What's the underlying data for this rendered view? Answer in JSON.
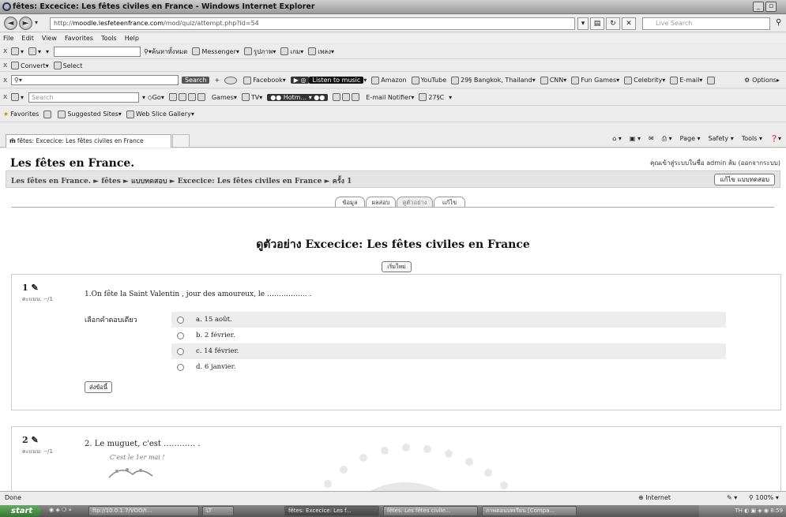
{
  "window": {
    "title": "fêtes: Excecice: Les fêtes civiles en France - Windows Internet Explorer"
  },
  "address": {
    "url_prefix": "http://",
    "url_host": "moodle.lesfeteenfrance.com",
    "url_path": "/mod/quiz/attempt.php?id=54",
    "search_placeholder": "Live Search"
  },
  "menu": [
    "File",
    "Edit",
    "View",
    "Favorites",
    "Tools",
    "Help"
  ],
  "toolbar2": {
    "search_label": "ค้นหาทั้งหมด",
    "messenger": "Messenger",
    "item3": "รูปภาพ",
    "item4": "เกม",
    "item5": "เพลง"
  },
  "toolbar3": {
    "convert": "Convert",
    "select": "Select"
  },
  "toolbar4": {
    "search_btn": "Search",
    "items": [
      "Facebook",
      "Listen to music",
      "Amazon",
      "YouTube",
      "29§ Bangkok, Thailand",
      "CNN",
      "Fun Games",
      "Celebrity",
      "E-mail"
    ],
    "options": "Options"
  },
  "toolbar5": {
    "search_placeholder": "Search",
    "go": "Go",
    "games": "Games",
    "tv": "TV",
    "hotmail": "Hotm...",
    "email_notifier": "E-mail Notifier",
    "temp": "27§C"
  },
  "favbar": {
    "favorites": "Favorites",
    "suggested": "Suggested Sites",
    "web_slice": "Web Slice Gallery"
  },
  "tab": {
    "title": "fêtes: Excecice: Les fêtes civiles en France"
  },
  "tabtools": [
    "Page",
    "Safety",
    "Tools"
  ],
  "page": {
    "site_title": "Les fêtes en France.",
    "login_info": "คุณเข้าสู่ระบบในชื่อ admin ส้ม (ออกจากระบบ)",
    "breadcrumb": "Les fêtes en France. ► fêtes ► แบบทดสอบ ► Excecice: Les fêtes civiles en France ► ครั้ง 1",
    "edit_button": "แก้ไข แบบทดสอบ",
    "tabs": [
      "ข้อมูล",
      "ผลสอบ",
      "ดูตัวอย่าง",
      "แก้ไข"
    ],
    "preview_title": "ดูตัวอย่าง Excecice: Les fêtes civiles en France",
    "restart_button": "เริ่มใหม่",
    "questions": [
      {
        "number": "1",
        "marks": "คะแนน: --/1",
        "text": "1.On  fête la Saint Valentin , jour des amoureux, le …………….. .",
        "answer_label": "เลือกคำตอบเดียว",
        "options": [
          "a. 15 août.",
          "b. 2 février.",
          "c. 14 février.",
          "d. 6 janvier."
        ],
        "submit": "ส่งข้อนี้"
      },
      {
        "number": "2",
        "marks": "คะแนน: --/1",
        "text": "2.  Le muguet, c'est ………… .",
        "image_caption": "C'est le 1er mai !"
      }
    ]
  },
  "status": {
    "left": "Done",
    "zone": "Internet",
    "zoom": "100%"
  },
  "taskbar": {
    "start": "start",
    "tasks": [
      "ftp://10.0.1.7/VOO/t...",
      "LT",
      "fêtes: Excecice: Les f...",
      "fêtes: Les fêtes civile...",
      "ภาพตอนบทเรียน [Compa..."
    ],
    "clock": "8:59"
  },
  "colors": {
    "page_bg": "#ffffff",
    "option_shade": "#ededed",
    "nav_bg": "#e4e4e4"
  }
}
